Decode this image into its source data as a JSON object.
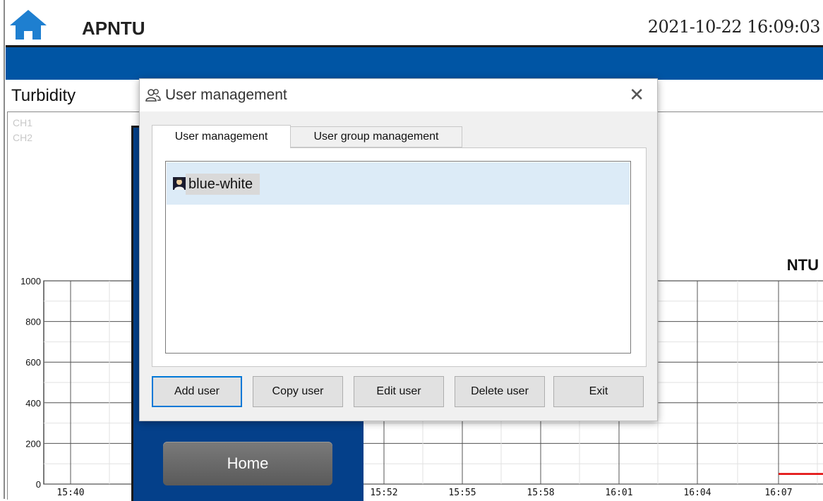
{
  "header": {
    "app_title": "APNTU",
    "datetime": "2021-10-22 16:09:03",
    "home_icon": "home-icon",
    "accent_blue": "#0055a4"
  },
  "panel": {
    "title": "Turbidity",
    "legend": [
      "CH1",
      "CH2"
    ],
    "unit": "NTU"
  },
  "chart_data": {
    "type": "line",
    "ylabel": "NTU",
    "ylim": [
      0,
      1000
    ],
    "y_ticks": [
      "1000",
      "800",
      "600",
      "400",
      "200",
      "0"
    ],
    "x_ticks": [
      "15:40",
      "15:52",
      "15:55",
      "15:58",
      "16:01",
      "16:04",
      "16:07"
    ],
    "series": [
      {
        "name": "CH1",
        "color": "#e00000",
        "x": [
          "16:07",
          "16:09"
        ],
        "values": [
          50,
          50
        ]
      }
    ],
    "grid": true
  },
  "menu": {
    "home_label": "Home"
  },
  "dialog": {
    "title": "User management",
    "close_glyph": "✕",
    "tabs": [
      {
        "label": "User management",
        "active": true
      },
      {
        "label": "User group management",
        "active": false
      }
    ],
    "users": [
      {
        "name": "blue-white",
        "icon": "user-icon",
        "selected": true
      }
    ],
    "buttons": {
      "add": "Add user",
      "copy": "Copy user",
      "edit": "Edit user",
      "delete": "Delete user",
      "exit": "Exit"
    }
  }
}
